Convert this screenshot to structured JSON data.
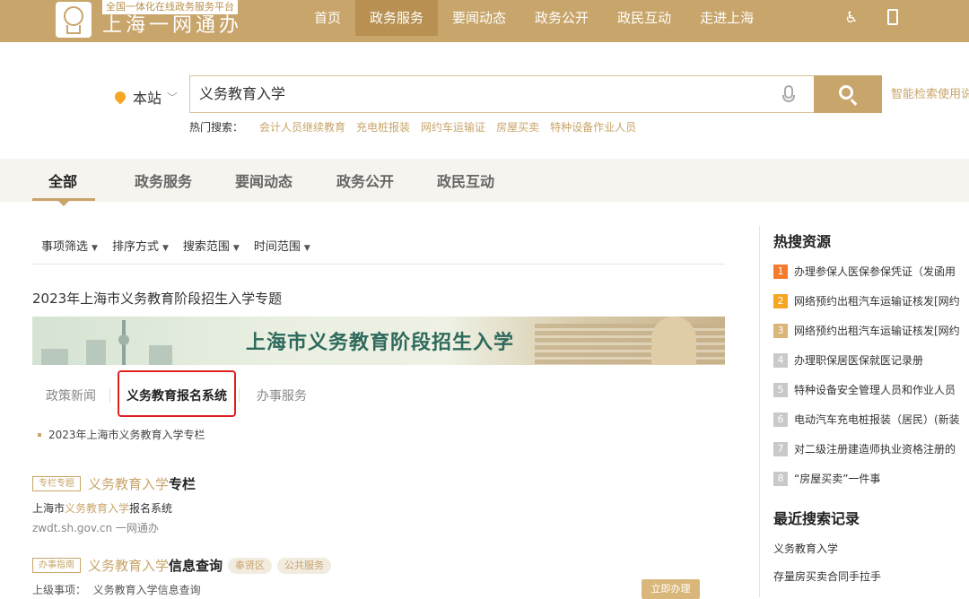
{
  "header": {
    "tagline": "全国一体化在线政务服务平台",
    "site_name": "上海一网通办",
    "nav": [
      "首页",
      "政务服务",
      "要闻动态",
      "政务公开",
      "政民互动",
      "走进上海"
    ],
    "accessibility_glyph": "♿"
  },
  "search": {
    "scope_label": "本站",
    "scope_arrow": "﹀",
    "query": "义务教育入学",
    "smart_link": "智能检索使用说明",
    "hot_label": "热门搜索：",
    "hot_keywords": [
      "会计人员继续教育",
      "充电桩报装",
      "网约车运输证",
      "房屋买卖",
      "特种设备作业人员"
    ]
  },
  "tabs": [
    "全部",
    "政务服务",
    "要闻动态",
    "政务公开",
    "政民互动"
  ],
  "filters": [
    {
      "label": "事项筛选",
      "arrow": "▼"
    },
    {
      "label": "排序方式",
      "arrow": "▼"
    },
    {
      "label": "搜索范围",
      "arrow": "▼"
    },
    {
      "label": "时间范围",
      "arrow": "▼"
    }
  ],
  "topic": {
    "title": "2023年上海市义务教育阶段招生入学专题",
    "banner_text": "上海市义务教育阶段招生入学",
    "subtabs": [
      "政策新闻",
      "义务教育报名系统",
      "办事服务"
    ],
    "bullet": "2023年上海市义务教育入学专栏"
  },
  "results": [
    {
      "badge": "专栏专题",
      "title_key": "义务教育入学",
      "title_rest": "专栏",
      "line_pre": "上海市",
      "line_key": "义务教育入学",
      "line_post": "报名系统",
      "url": "zwdt.sh.gov.cn   一网通办"
    },
    {
      "badge": "办事指南",
      "title_key": "义务教育入学",
      "title_rest": "信息查询",
      "tags": [
        "奉贤区",
        "公共服务"
      ],
      "parent_label": "上级事项：",
      "parent_value": "义务教育入学信息查询",
      "button": "立即办理"
    }
  ],
  "sidebar": {
    "hot_title": "热搜资源",
    "hot_items": [
      {
        "num": "1",
        "text": "办理参保人医保参保凭证（发函用"
      },
      {
        "num": "2",
        "text": "网络预约出租汽车运输证核发[网约"
      },
      {
        "num": "3",
        "text": "网络预约出租汽车运输证核发[网约"
      },
      {
        "num": "4",
        "text": "办理职保居医保就医记录册"
      },
      {
        "num": "5",
        "text": "特种设备安全管理人员和作业人员"
      },
      {
        "num": "6",
        "text": "电动汽车充电桩报装（居民）(新装"
      },
      {
        "num": "7",
        "text": "对二级注册建造师执业资格注册的"
      },
      {
        "num": "8",
        "text": "“房屋买卖”一件事"
      }
    ],
    "recent_title": "最近搜索记录",
    "recent": [
      "义务教育入学",
      "存量房买卖合同手拉手"
    ]
  }
}
